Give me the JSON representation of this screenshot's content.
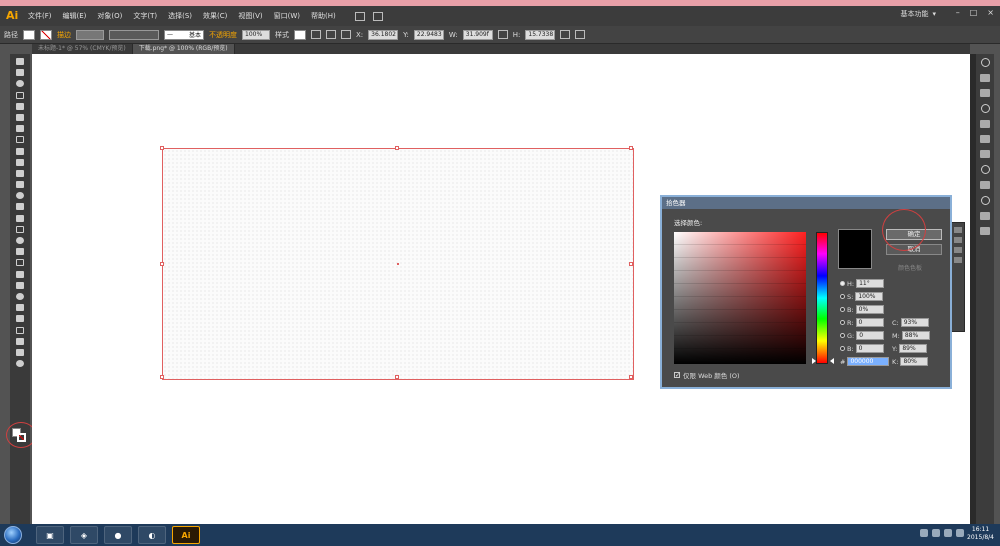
{
  "app": {
    "logo": "Ai"
  },
  "menu": [
    "文件(F)",
    "编辑(E)",
    "对象(O)",
    "文字(T)",
    "选择(S)",
    "效果(C)",
    "视图(V)",
    "窗口(W)",
    "帮助(H)"
  ],
  "workspace": "基本功能",
  "window_controls": [
    "–",
    "□",
    "×"
  ],
  "control_bar": {
    "selection_label": "路径",
    "stroke_label": "描边",
    "stroke_style": "基本",
    "opacity_label": "不透明度",
    "opacity_value": "100%",
    "style_label": "样式",
    "x_value": "36.1802",
    "y_value": "22.9483",
    "w_value": "31.909f",
    "h_value": "15.7338"
  },
  "tabs": [
    {
      "label": "未标题-1* @ 57% (CMYK/预览)",
      "active": false
    },
    {
      "label": "下载.png* @ 100% (RGB/预览)",
      "active": true
    }
  ],
  "color_picker": {
    "title": "拾色器",
    "select_label": "选择颜色:",
    "ok_label": "确定",
    "cancel_label": "取消",
    "swatches_label": "颜色色板",
    "h_label": "H:",
    "h_value": "11°",
    "s_label": "S:",
    "s_value": "100%",
    "b_label": "B:",
    "b_value": "0%",
    "r_label": "R:",
    "r_value": "0",
    "g_label": "G:",
    "g_value": "0",
    "bl_label": "B:",
    "bl_value": "0",
    "c_label": "C:",
    "c_value": "93%",
    "m_label": "M:",
    "m_value": "88%",
    "y_label": "Y:",
    "y_value": "89%",
    "k_label": "K:",
    "k_value": "80%",
    "hex_label": "#",
    "hex_value": "000000",
    "web_only_label": "仅限 Web 颜色 (O)",
    "preview_color": "#000000"
  },
  "taskbar": {
    "ai_label": "Ai",
    "clock_time": "16:11",
    "clock_date": "2015/8/4"
  },
  "colors": {
    "accent": "#f7a600",
    "selection": "#e06060",
    "taskbar": "#1e3a5a"
  }
}
